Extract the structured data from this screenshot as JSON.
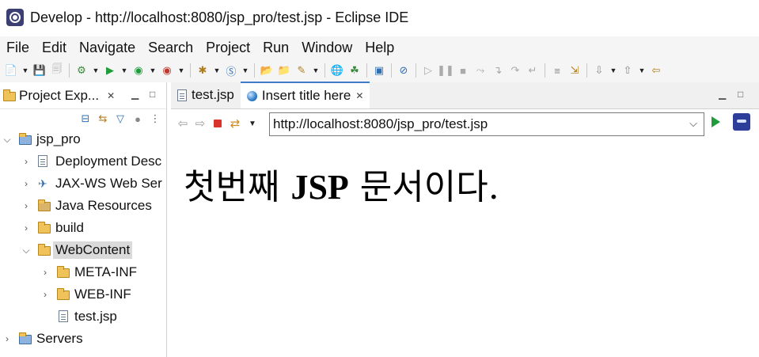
{
  "window": {
    "title": "Develop - http://localhost:8080/jsp_pro/test.jsp - Eclipse IDE"
  },
  "menu": [
    "File",
    "Edit",
    "Navigate",
    "Search",
    "Project",
    "Run",
    "Window",
    "Help"
  ],
  "left_panel": {
    "tab_label": "Project Exp...",
    "tree": [
      {
        "label": "jsp_pro",
        "depth": 0,
        "expanded": true,
        "icon": "project-icon"
      },
      {
        "label": "Deployment Desc",
        "depth": 1,
        "expanded": false,
        "icon": "deployment-descriptor-icon"
      },
      {
        "label": "JAX-WS Web Ser",
        "depth": 1,
        "expanded": false,
        "icon": "jaxws-icon"
      },
      {
        "label": "Java Resources",
        "depth": 1,
        "expanded": false,
        "icon": "java-resources-icon"
      },
      {
        "label": "build",
        "depth": 1,
        "expanded": false,
        "icon": "folder-icon"
      },
      {
        "label": "WebContent",
        "depth": 1,
        "expanded": true,
        "icon": "folder-open-icon",
        "selected": true
      },
      {
        "label": "META-INF",
        "depth": 2,
        "expanded": false,
        "icon": "folder-icon"
      },
      {
        "label": "WEB-INF",
        "depth": 2,
        "expanded": false,
        "icon": "folder-icon"
      },
      {
        "label": "test.jsp",
        "depth": 2,
        "leaf": true,
        "icon": "jsp-file-icon"
      },
      {
        "label": "Servers",
        "depth": 0,
        "expanded": false,
        "icon": "servers-folder-icon"
      }
    ]
  },
  "editor": {
    "tabs": [
      {
        "label": "test.jsp",
        "active": false,
        "icon": "jsp-file-icon"
      },
      {
        "label": "Insert title here",
        "active": true,
        "icon": "browser-globe-icon"
      }
    ],
    "browser": {
      "url": "http://localhost:8080/jsp_pro/test.jsp"
    },
    "page": {
      "text_part1": "첫번째 ",
      "text_bold": "JSP",
      "text_part2": " 문서이다."
    }
  },
  "colors": {
    "accent": "#3f7bc7",
    "stop": "#d9342b",
    "go": "#1f9b3a",
    "selection": "#dadada"
  }
}
